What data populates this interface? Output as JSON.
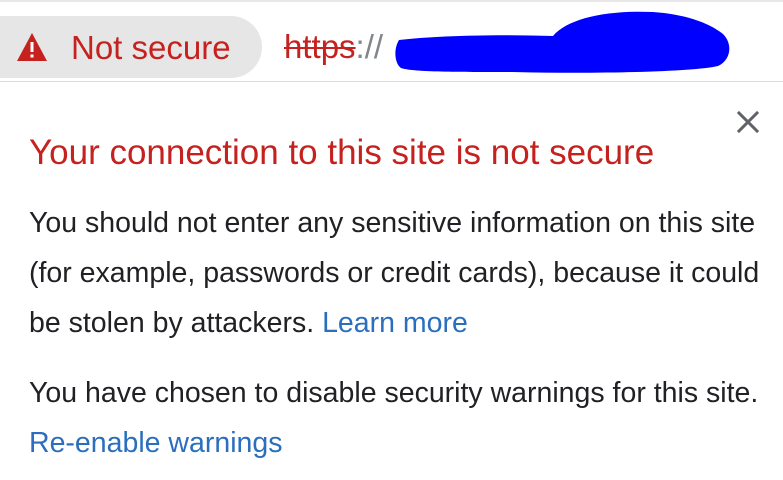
{
  "omnibox": {
    "security_chip_label": "Not secure",
    "security_icon": "warning-triangle-icon",
    "url_scheme": "https",
    "url_separator": "://",
    "url_host_redacted": true
  },
  "popup": {
    "title": "Your connection to this site is not secure",
    "close_icon": "close-icon",
    "paragraph1": {
      "text": "You should not enter any sensitive information on this site (for example, passwords or credit cards), because it could be stolen by attackers.",
      "link_label": "Learn more"
    },
    "paragraph2": {
      "text": "You have chosen to disable security warnings for this site.",
      "link_label": "Re-enable warnings"
    }
  },
  "colors": {
    "danger_red": "#c5221f",
    "link_blue": "#2a6ebd",
    "chip_background": "#e6e6e6",
    "body_text": "#202124",
    "redaction_blue": "#0000ff"
  }
}
